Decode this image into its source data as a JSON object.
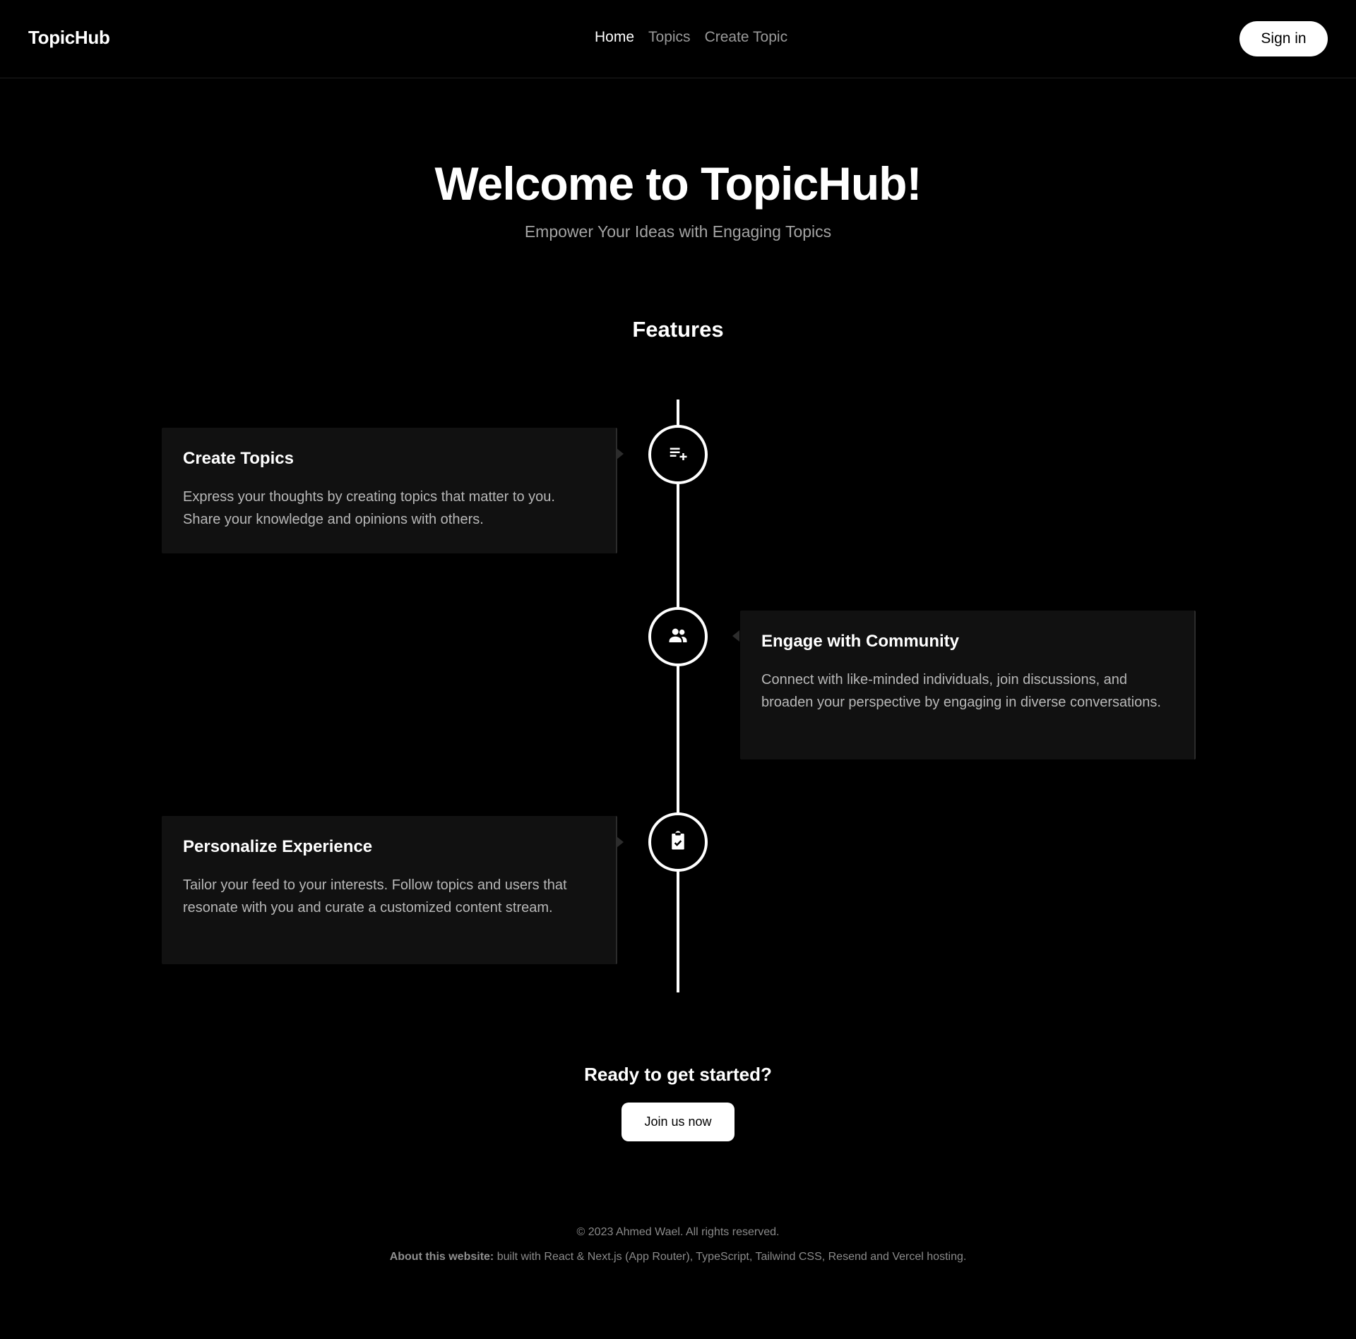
{
  "header": {
    "logo": "TopicHub",
    "nav": [
      {
        "label": "Home",
        "active": true
      },
      {
        "label": "Topics",
        "active": false
      },
      {
        "label": "Create Topic",
        "active": false
      }
    ],
    "signin_label": "Sign in"
  },
  "hero": {
    "title": "Welcome to TopicHub!",
    "subtitle": "Empower Your Ideas with Engaging Topics"
  },
  "features": {
    "title": "Features",
    "items": [
      {
        "title": "Create Topics",
        "description": "Express your thoughts by creating topics that matter to you. Share your knowledge and opinions with others.",
        "icon": "playlist-add-icon",
        "side": "left"
      },
      {
        "title": "Engage with Community",
        "description": "Connect with like-minded individuals, join discussions, and broaden your perspective by engaging in diverse conversations.",
        "icon": "people-icon",
        "side": "right"
      },
      {
        "title": "Personalize Experience",
        "description": "Tailor your feed to your interests. Follow topics and users that resonate with you and curate a customized content stream.",
        "icon": "clipboard-check-icon",
        "side": "left"
      }
    ]
  },
  "cta": {
    "title": "Ready to get started?",
    "button_label": "Join us now"
  },
  "footer": {
    "copyright": "© 2023 Ahmed Wael. All rights reserved.",
    "about_label": "About this website:",
    "about_text": " built with React & Next.js (App Router), TypeScript, Tailwind CSS, Resend and Vercel hosting."
  },
  "colors": {
    "background": "#000000",
    "card": "#111111",
    "muted_text": "#a3a3a3",
    "accent": "#ffffff"
  }
}
